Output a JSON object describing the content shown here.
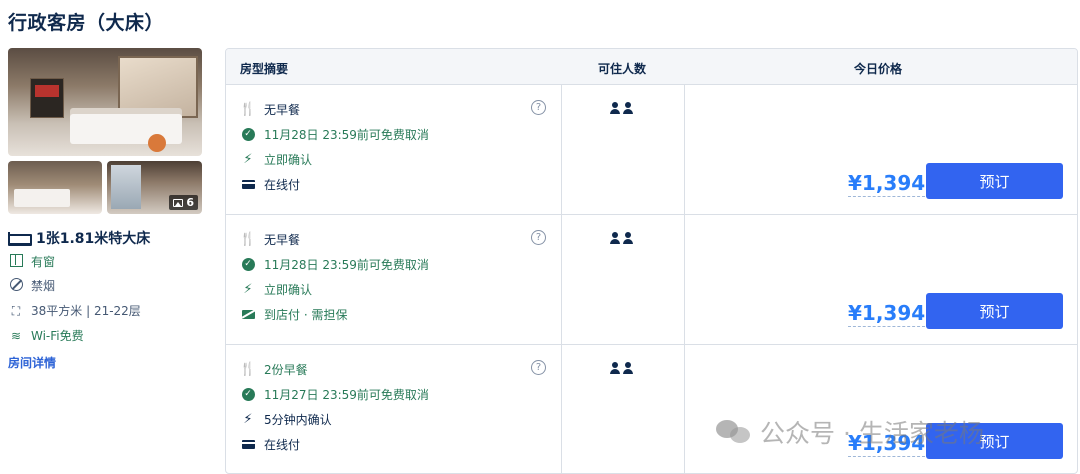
{
  "room": {
    "title": "行政客房（大床）",
    "photo_count": "6",
    "bed": "1张1.81米特大床",
    "facilities": {
      "window": "有窗",
      "smoking": "禁烟",
      "area_floor": "38平方米 | 21-22层",
      "wifi": "Wi-Fi免费"
    },
    "detail_link": "房间详情"
  },
  "table": {
    "headers": {
      "summary": "房型摘要",
      "guests": "可住人数",
      "price": "今日价格"
    },
    "rows": [
      {
        "meal": "无早餐",
        "cancel": "11月28日 23:59前可免费取消",
        "confirm": "立即确认",
        "payment": "在线付",
        "price": "¥1,394",
        "book": "预订"
      },
      {
        "meal": "无早餐",
        "cancel": "11月28日 23:59前可免费取消",
        "confirm": "立即确认",
        "payment": "到店付 · 需担保",
        "price": "¥1,394",
        "book": "预订"
      },
      {
        "meal": "2份早餐",
        "cancel": "11月27日 23:59前可免费取消",
        "confirm": "5分钟内确认",
        "payment": "在线付",
        "price": "¥1,394",
        "book": "预订"
      }
    ]
  },
  "watermark": "公众号 · 生活家老杨",
  "colors": {
    "green": "#287a58",
    "price_blue": "#287dfa",
    "button_blue": "#3264f0",
    "text_dark": "#0f294d"
  }
}
